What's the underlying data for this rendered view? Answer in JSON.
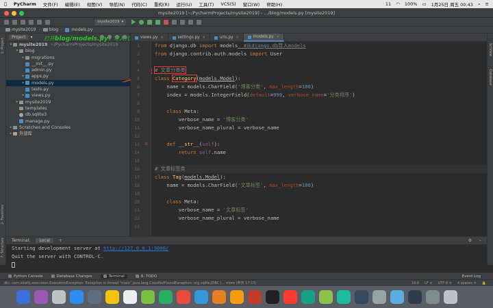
{
  "menubar": {
    "app": "PyCharm",
    "items": [
      "文件(F)",
      "编辑(E)",
      "视图(V)",
      "导航(N)",
      "代码(C)",
      "重构(R)",
      "运行(U)",
      "工具(T)",
      "VCS(S)",
      "窗口(W)",
      "帮助(H)"
    ],
    "right": {
      "badge": "11",
      "battery": "100%",
      "datetime": "1月25日 周五 00:43"
    }
  },
  "window": {
    "title": "mysite2019 [~/PycharmProjects/mysite2019] - .../blog/models.py [mysite2019]"
  },
  "toolbar": {
    "run_config": "mysite2019"
  },
  "breadcrumb": [
    "mysite2019",
    "blog",
    "models.py"
  ],
  "project_panel": {
    "title": "Project",
    "tree": [
      {
        "label": "mysite2019",
        "suffix": "~/PycharmProjects/mysite2019",
        "indent": 0,
        "arrow": "▾",
        "icon": "folder"
      },
      {
        "label": "blog",
        "indent": 1,
        "arrow": "▾",
        "icon": "pkg"
      },
      {
        "label": "migrations",
        "indent": 2,
        "arrow": "▸",
        "icon": "pkg"
      },
      {
        "label": "__init__.py",
        "indent": 2,
        "arrow": "",
        "icon": "py"
      },
      {
        "label": "admin.py",
        "indent": 2,
        "arrow": "",
        "icon": "py"
      },
      {
        "label": "apps.py",
        "indent": 2,
        "arrow": "▸",
        "icon": "py"
      },
      {
        "label": "models.py",
        "indent": 2,
        "arrow": "▸",
        "icon": "py",
        "selected": true
      },
      {
        "label": "tests.py",
        "indent": 2,
        "arrow": "",
        "icon": "py"
      },
      {
        "label": "views.py",
        "indent": 2,
        "arrow": "▸",
        "icon": "py"
      },
      {
        "label": "mysite2019",
        "indent": 1,
        "arrow": "▸",
        "icon": "pkg"
      },
      {
        "label": "templates",
        "indent": 1,
        "arrow": "",
        "icon": "folder"
      },
      {
        "label": "db.sqlite3",
        "indent": 1,
        "arrow": "",
        "icon": "db"
      },
      {
        "label": "manage.py",
        "indent": 1,
        "arrow": "",
        "icon": "py"
      },
      {
        "label": "Scratches and Consoles",
        "indent": 0,
        "arrow": "▸",
        "icon": "folder"
      },
      {
        "label": "外部库",
        "indent": 0,
        "arrow": "▸",
        "icon": "lib"
      }
    ]
  },
  "annotation": {
    "prefix": "打开",
    "path": "blog/models.py",
    "suffix": "，写入代码"
  },
  "left_strip": {
    "project": "1: Project",
    "favorites": "2: Favorites",
    "structure": "7: Structure"
  },
  "right_strip": {
    "scientific": "SciView",
    "database": "Database"
  },
  "tabs": [
    {
      "label": "views.py",
      "active": false
    },
    {
      "label": "settings.py",
      "active": false
    },
    {
      "label": "urls.py",
      "active": false
    },
    {
      "label": "models.py",
      "active": true
    }
  ],
  "code": {
    "line_numbers": [
      "1",
      "2",
      "3",
      "4",
      "5",
      "6",
      "7",
      "8",
      "9",
      "10",
      "11",
      "12",
      "13",
      "14",
      "15",
      "16",
      "17",
      "18",
      "19",
      "20",
      "21",
      "22",
      "23"
    ],
    "l1": {
      "kw1": "from",
      "mod": " django.db ",
      "kw2": "import",
      "rest": " models",
      "cm": "  #从django.db导入models"
    },
    "l2": {
      "kw1": "from",
      "mod": " django.contrib.auth.models ",
      "kw2": "import",
      "rest": " User"
    },
    "l4": {
      "cm": "# 文章分类类"
    },
    "l5": {
      "kw": "class",
      "name": "Category",
      "p1": "(",
      "base": "models.Model",
      "p2": "):"
    },
    "l6": {
      "a": "    name = models.CharField(",
      "s": "'博客分类'",
      "c": ", ",
      "k": "max_length",
      "e": "=",
      "n": "100",
      "z": ")"
    },
    "l7": {
      "a": "    index = models.IntegerField(",
      "k1": "default",
      "e1": "=",
      "n": "999",
      "c": ", ",
      "k2": "verbose_name",
      "e2": "=",
      "s": "'分类排序'",
      "z": ")"
    },
    "l9": {
      "kw": "    class",
      "rest": " Meta:"
    },
    "l10": {
      "a": "        verbose_name = ",
      "s": "'博客分类'"
    },
    "l11": {
      "a": "        verbose_name_plural = verbose_name"
    },
    "l13": {
      "kw": "    def",
      "fn": " __str__",
      "p1": "(",
      "self": "self",
      "p2": "):"
    },
    "l14": {
      "kw": "        return",
      "self": " self",
      "rest": ".name"
    },
    "l16": {
      "cm": "# 文章标签类"
    },
    "l17": {
      "kw": "class",
      "name": "Tag",
      "p1": "(",
      "base": "models.Model",
      "p2": "):"
    },
    "l18": {
      "a": "    name = models.CharField(",
      "s": "'文章标签'",
      "c": ", ",
      "k": "max_length",
      "e": "=",
      "n": "100",
      "z": ")"
    },
    "l20": {
      "kw": "    class",
      "rest": " Meta:"
    },
    "l21": {
      "a": "        verbose_name = ",
      "s": "'文章标签'"
    },
    "l22": {
      "a": "        verbose_name_plural = verbose_name"
    }
  },
  "terminal": {
    "title": "Terminal:",
    "tab": "Local",
    "plus": "+",
    "line1_prefix": "Starting development server at ",
    "line1_link": "http://127.0.0.1:9000/",
    "line2": "Quit the server with CONTROL-C."
  },
  "bottom_tabs": [
    {
      "label": "Python Console",
      "active": false
    },
    {
      "label": "Database Changes",
      "active": false
    },
    {
      "label": "Terminal",
      "active": true
    },
    {
      "label": "6: TODO",
      "active": false
    }
  ],
  "event_log": "Event Log",
  "status": {
    "message": "dtc: com.intellij.execution.ExecutionException: Exception in thread \"main\" java.lang.ClassNotFoundException: org.sqlite.JDBC (... more (昨天 17:13)",
    "position": "16:6",
    "line_sep": "LF ≑",
    "encoding": "UTF-8 ≑",
    "indent": "4 spaces ≑"
  },
  "dock_colors": [
    "#3b6fd8",
    "#9b59b6",
    "#bdc3c7",
    "#2d8cf0",
    "#5d6d7e",
    "#f1c40f",
    "#ecf0f1",
    "#7bc043",
    "#27ae60",
    "#e74c3c",
    "#3498db",
    "#e67e22",
    "#f39c12",
    "#c0392b",
    "#222222",
    "#ff3b30",
    "#16a085",
    "#8bc34a",
    "#1abc9c",
    "#34495e",
    "#95a5a6",
    "#5dade2",
    "#2c3e50",
    "#7f8c8d",
    "#bdc3c7"
  ]
}
